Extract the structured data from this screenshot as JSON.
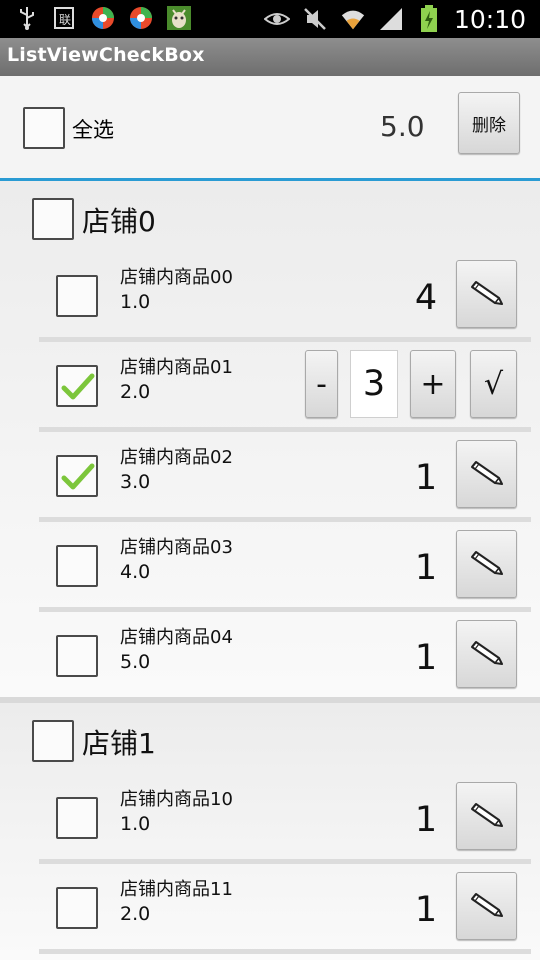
{
  "status_bar": {
    "time": "10:10",
    "left_icons": [
      "usb-icon",
      "sim-icon",
      "app-ball-icon",
      "app-ball-icon",
      "android-icon"
    ],
    "right_icons": [
      "eye-icon",
      "mute-icon",
      "wifi-icon",
      "signal-icon",
      "battery-icon"
    ]
  },
  "app": {
    "title": "ListViewCheckBox"
  },
  "header": {
    "select_all_label": "全选",
    "total": "5.0",
    "delete_label": "删除",
    "select_all_checked": false
  },
  "shops": [
    {
      "name": "店铺0",
      "checked": false,
      "items": [
        {
          "name": "店铺内商品00",
          "price": "1.0",
          "qty": "4",
          "checked": false,
          "editing": false
        },
        {
          "name": "店铺内商品01",
          "price": "2.0",
          "qty": "3",
          "checked": true,
          "editing": true
        },
        {
          "name": "店铺内商品02",
          "price": "3.0",
          "qty": "1",
          "checked": true,
          "editing": false
        },
        {
          "name": "店铺内商品03",
          "price": "4.0",
          "qty": "1",
          "checked": false,
          "editing": false
        },
        {
          "name": "店铺内商品04",
          "price": "5.0",
          "qty": "1",
          "checked": false,
          "editing": false
        }
      ]
    },
    {
      "name": "店铺1",
      "checked": false,
      "items": [
        {
          "name": "店铺内商品10",
          "price": "1.0",
          "qty": "1",
          "checked": false,
          "editing": false
        },
        {
          "name": "店铺内商品11",
          "price": "2.0",
          "qty": "1",
          "checked": false,
          "editing": false
        }
      ]
    }
  ],
  "stepper": {
    "minus_label": "-",
    "plus_label": "+",
    "confirm_label": "√"
  },
  "colors": {
    "accent_divider": "#2a9bd3",
    "check_green": "#7cc63b",
    "title_bar": "#7d7d7d"
  }
}
